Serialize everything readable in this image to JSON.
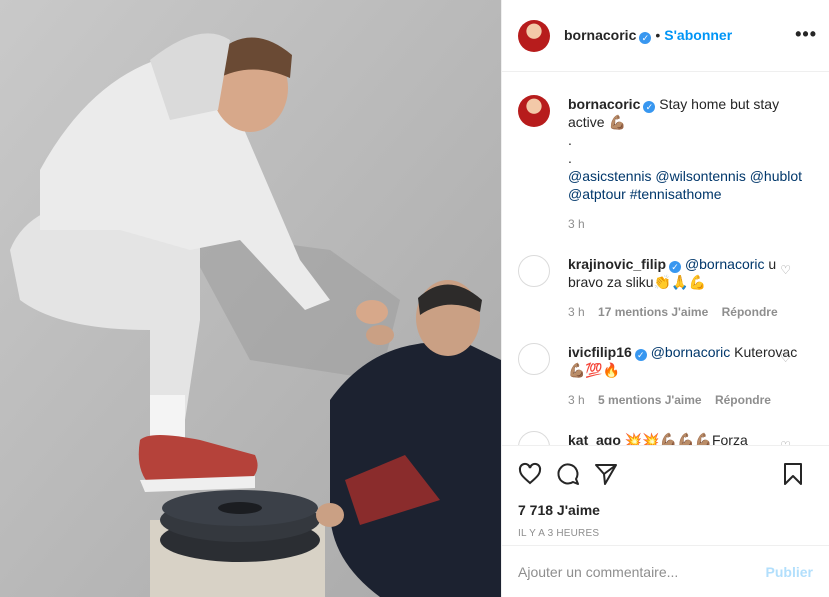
{
  "post": {
    "image_alt": "",
    "author": "bornacoric",
    "follow_label": "S'abonner",
    "separator": "•",
    "more_label": "•••",
    "caption_line1": "Stay home but stay active 💪🏽",
    "caption_dot1": ".",
    "caption_dot2": ".",
    "caption_links": "@asicstennis @wilsontennis @hublot @atptour #tennisathome",
    "caption_time": "3 h"
  },
  "comments": [
    {
      "user": "krajinovic_filip",
      "mention": "@bornacoric",
      "text": " u bravo za sliku👏🙏💪",
      "time": "3 h",
      "likes": "17 mentions J'aime",
      "reply": "Répondre"
    },
    {
      "user": "ivicfilip16",
      "mention": "@bornacoric",
      "text": " Kuterovac 💪🏽💯🔥",
      "time": "3 h",
      "likes": "5 mentions J'aime",
      "reply": "Répondre"
    },
    {
      "user": "kat_ago",
      "mention": "",
      "text": " 💥💥💪🏽💪🏽💪🏽Forza",
      "time": "",
      "likes": "",
      "reply": ""
    }
  ],
  "actions": {
    "likes_count": "7 718 J'aime",
    "time_ago": "IL Y A 3 HEURES"
  },
  "add_comment": {
    "placeholder": "Ajouter un commentaire...",
    "publish_label": "Publier"
  },
  "colors": {
    "accent": "#0095f6",
    "verified": "#3897f0",
    "publish_disabled": "#b2dffc"
  },
  "icons": [
    "heart-icon",
    "comment-icon",
    "share-icon",
    "bookmark-icon",
    "verified-icon",
    "more-icon"
  ]
}
